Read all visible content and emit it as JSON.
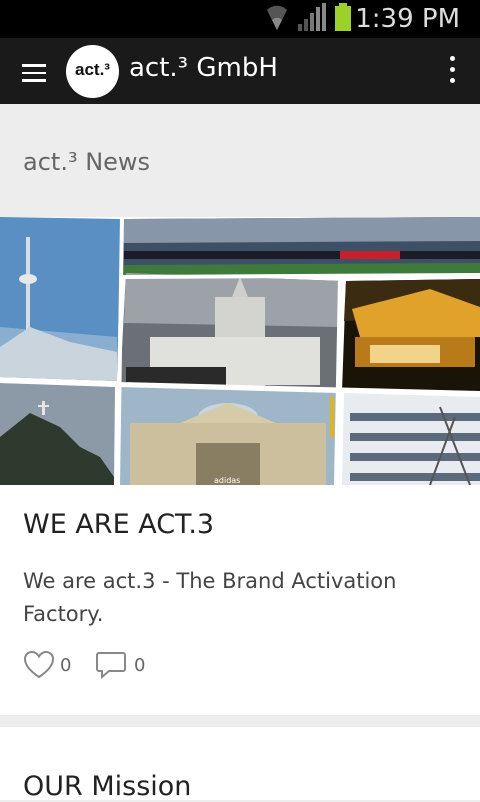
{
  "status_bar": {
    "time": "1:39 PM",
    "icons": [
      "wifi-icon",
      "signal-icon",
      "battery-icon"
    ]
  },
  "app_bar": {
    "logo_text": "act.³",
    "title": "act.³ GmbH",
    "menu_icon": "hamburger-icon",
    "overflow_icon": "more-vert-icon"
  },
  "section": {
    "title": "act.³ News"
  },
  "posts": [
    {
      "title": "WE ARE ACT.3",
      "body": "We are act.3 - The Brand Activation Factory.",
      "likes": "0",
      "comments": "0",
      "image_caption": "adidas"
    },
    {
      "title": "OUR Mission"
    }
  ],
  "colors": {
    "app_bar": "#1a1a1a",
    "status_bar": "#000000",
    "background": "#ededed",
    "battery": "#9bd229"
  }
}
